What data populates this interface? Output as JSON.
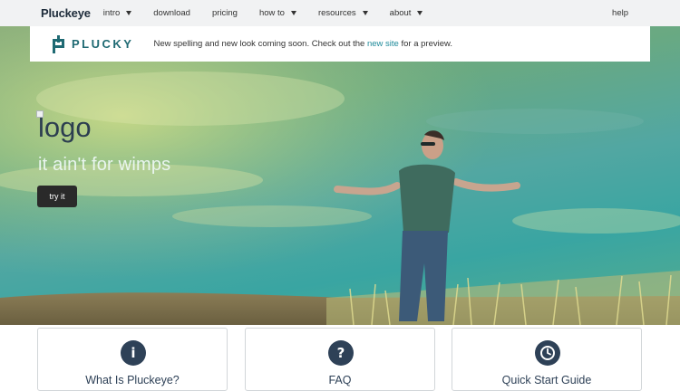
{
  "navbar": {
    "brand": "Pluckeye",
    "items": [
      {
        "label": "intro",
        "dropdown": true
      },
      {
        "label": "download",
        "dropdown": false
      },
      {
        "label": "pricing",
        "dropdown": false
      },
      {
        "label": "how to",
        "dropdown": true
      },
      {
        "label": "resources",
        "dropdown": true
      },
      {
        "label": "about",
        "dropdown": true
      }
    ],
    "help": "help"
  },
  "announcement": {
    "logo_text": "PLUCKY",
    "text_before": "New spelling and new look coming soon. Check out the ",
    "link_text": "new site",
    "text_after": " for a preview."
  },
  "hero": {
    "logo_alt": "logo",
    "tagline": "it ain't for wimps",
    "button_label": "try it"
  },
  "cards": [
    {
      "icon": "info-icon",
      "glyph": "i",
      "title": "What Is Pluckeye?"
    },
    {
      "icon": "question-icon",
      "glyph": "?",
      "title": "FAQ"
    },
    {
      "icon": "clock-icon",
      "glyph": "",
      "title": "Quick Start Guide"
    }
  ],
  "colors": {
    "nav_bg": "#f1f2f3",
    "brand_dark": "#1d2b3a",
    "plucky_teal": "#1f6a73",
    "link": "#1e8a9a",
    "card_icon": "#2e4157",
    "button_bg": "#2a2a2a"
  }
}
